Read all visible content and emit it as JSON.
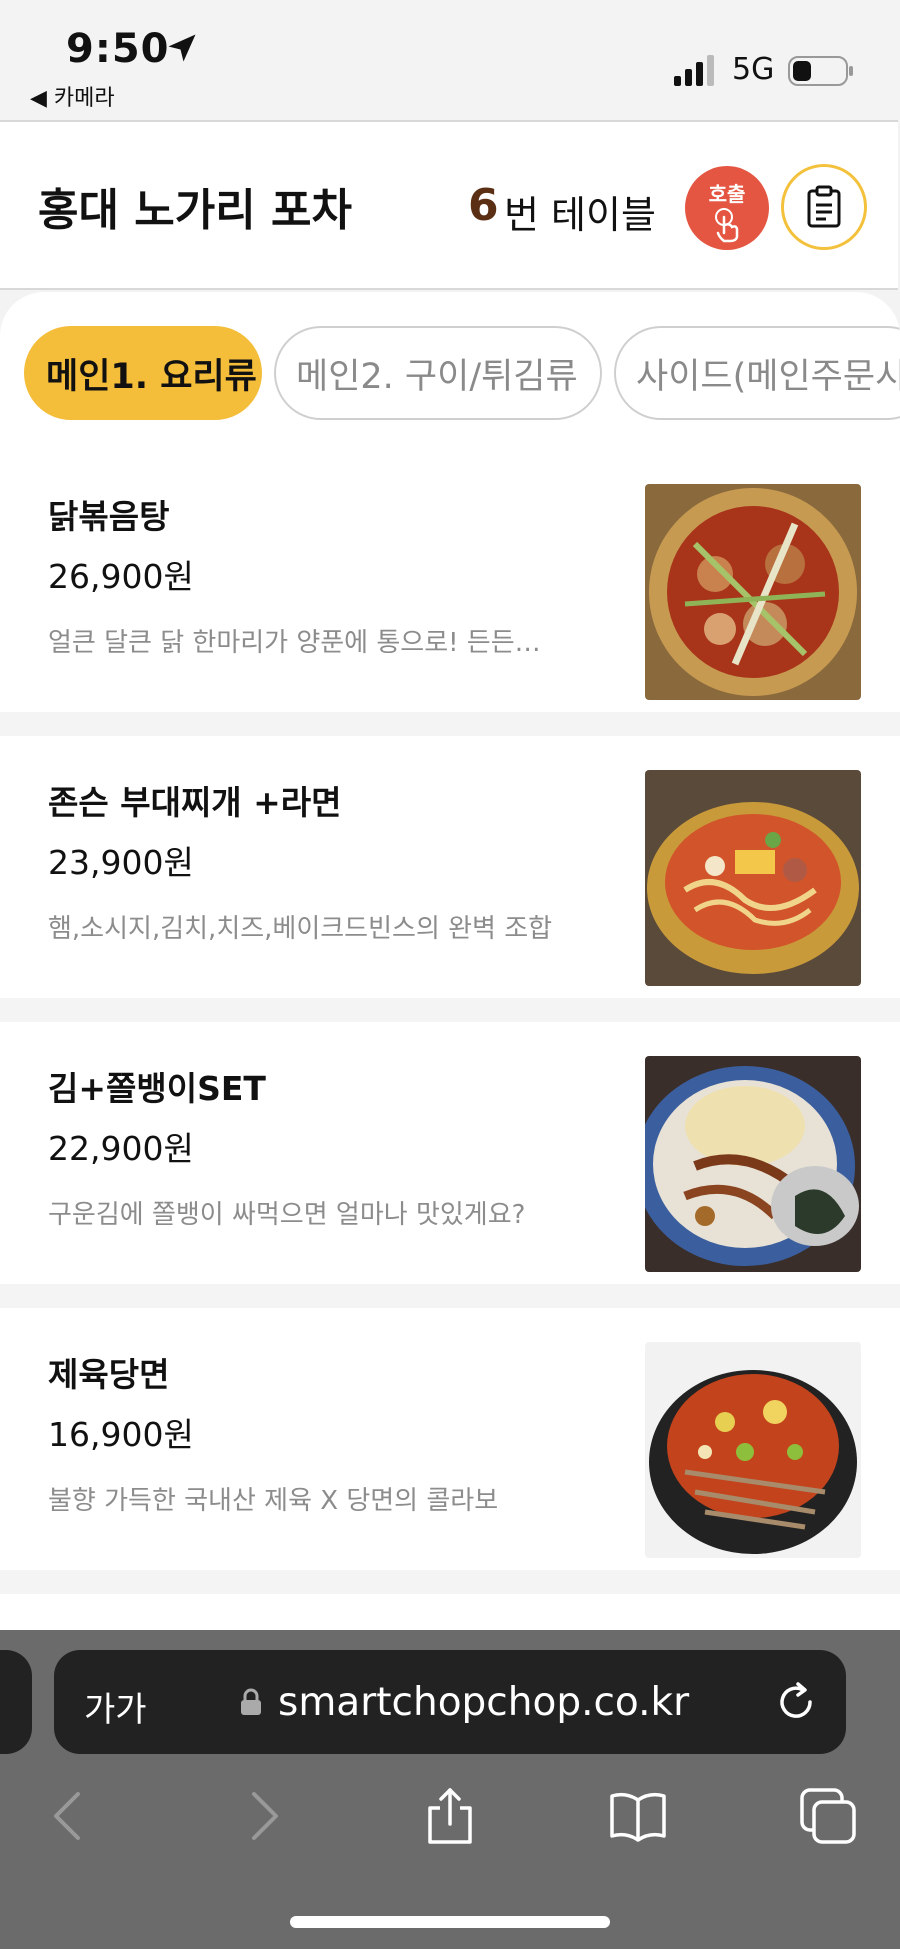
{
  "status": {
    "time": "9:50",
    "back_app": "◀ 카메라",
    "network": "5G"
  },
  "header": {
    "store_name": "홍대 노가리 포차",
    "table_number": "6",
    "table_label": "번 테이블",
    "call_label": "호출"
  },
  "tabs": [
    {
      "label": "메인1. 요리류",
      "active": true
    },
    {
      "label": "메인2. 구이/튀김류",
      "active": false
    },
    {
      "label": "사이드(메인주문시",
      "active": false
    }
  ],
  "menu": [
    {
      "name": "닭볶음탕",
      "price": "26,900원",
      "desc": "얼큰 달큰 닭 한마리가 양푼에 통으로! 든든…"
    },
    {
      "name": "존슨 부대찌개 +라면",
      "price": "23,900원",
      "desc": "햄,소시지,김치,치즈,베이크드빈스의 완벽 조합"
    },
    {
      "name": "김+쫄뱅이SET",
      "price": "22,900원",
      "desc": "구운김에 쫄뱅이 싸먹으면 얼마나 맛있게요?"
    },
    {
      "name": "제육당면",
      "price": "16,900원",
      "desc": "불향 가득한 국내산 제육 X 당면의 콜라보"
    }
  ],
  "browser": {
    "text_size_label": "가가",
    "url": "smartchopchop.co.kr"
  },
  "colors": {
    "accent": "#f4bd3a",
    "call": "#e55642",
    "brown": "#5a2f14"
  }
}
